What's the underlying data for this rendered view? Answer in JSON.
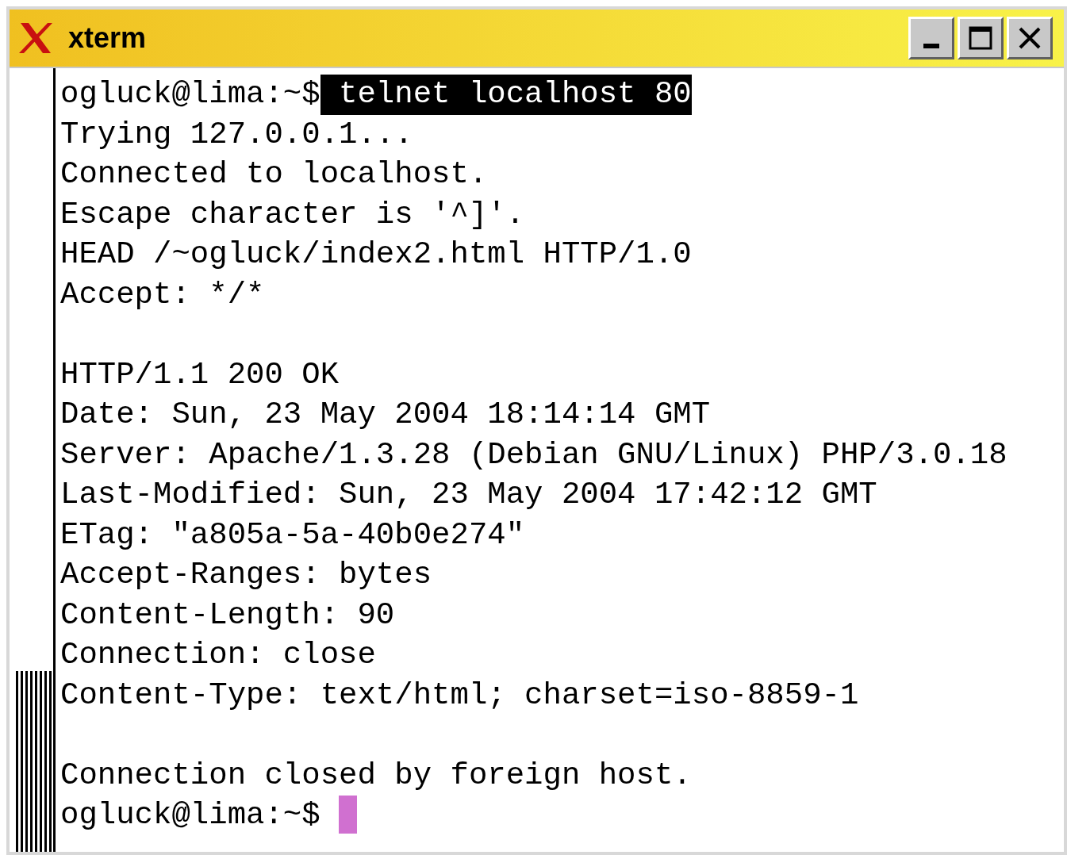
{
  "window": {
    "title": "xterm"
  },
  "title_buttons": [
    {
      "kind": "minimize"
    },
    {
      "kind": "maximize"
    },
    {
      "kind": "close"
    }
  ],
  "terminal": {
    "lines": [
      {
        "kind": "text",
        "text": "ogluck@lima:~$",
        "selected_text": " telnet localhost 80"
      },
      {
        "kind": "text",
        "text": "Trying 127.0.0.1..."
      },
      {
        "kind": "text",
        "text": "Connected to localhost."
      },
      {
        "kind": "text",
        "text": "Escape character is '^]'."
      },
      {
        "kind": "text",
        "text": "HEAD /~ogluck/index2.html HTTP/1.0"
      },
      {
        "kind": "text",
        "text": "Accept: */*"
      },
      {
        "kind": "blank"
      },
      {
        "kind": "text",
        "text": "HTTP/1.1 200 OK"
      },
      {
        "kind": "text",
        "text": "Date: Sun, 23 May 2004 18:14:14 GMT"
      },
      {
        "kind": "text",
        "text": "Server: Apache/1.3.28 (Debian GNU/Linux) PHP/3.0.18"
      },
      {
        "kind": "text",
        "text": "Last-Modified: Sun, 23 May 2004 17:42:12 GMT"
      },
      {
        "kind": "text",
        "text": "ETag: \"a805a-5a-40b0e274\""
      },
      {
        "kind": "text",
        "text": "Accept-Ranges: bytes"
      },
      {
        "kind": "text",
        "text": "Content-Length: 90"
      },
      {
        "kind": "text",
        "text": "Connection: close"
      },
      {
        "kind": "text",
        "text": "Content-Type: text/html; charset=iso-8859-1"
      },
      {
        "kind": "blank"
      },
      {
        "kind": "text",
        "text": "Connection closed by foreign host."
      },
      {
        "kind": "text",
        "text": "ogluck@lima:~$ ",
        "cursor": true
      }
    ]
  }
}
